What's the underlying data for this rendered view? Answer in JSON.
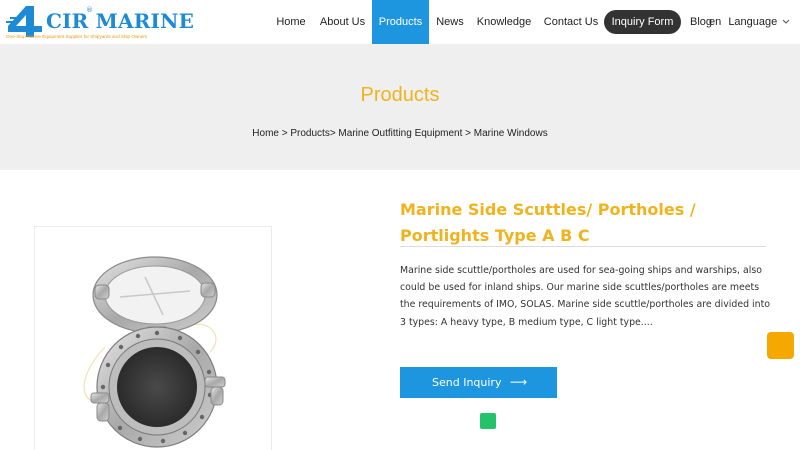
{
  "brand": {
    "name": "CIR MARINE",
    "registered": "®",
    "tagline": "One-Stop Marine Equipment Supplier for Shipyards and Ship Owners",
    "color": "#1d8ad6",
    "accent": "#e89a12"
  },
  "nav": {
    "items": [
      {
        "label": "Home"
      },
      {
        "label": "About Us"
      },
      {
        "label": "Products",
        "active": true
      },
      {
        "label": "News"
      },
      {
        "label": "Knowledge"
      },
      {
        "label": "Contact Us"
      }
    ],
    "inquiry_label": "Inquiry Form",
    "blog_label": "Blog",
    "lang_code": "en",
    "language_label": "Language",
    "active_color": "#1e96df"
  },
  "banner": {
    "title": "Products",
    "breadcrumb": "Home > Products> Marine Outfitting Equipment > Marine Windows"
  },
  "product": {
    "title": "Marine Side Scuttles/ Portholes / Portlights Type A B C",
    "description": "Marine side scuttle/portholes are used for sea-going ships and warships, also could be used for inland ships. Our marine side scuttles/portholes are meets the requirements of IMO, SOLAS. Marine side scuttle/portholes are divided into 3 types: A heavy type, B medium type, C light type....",
    "send_label": "Send Inquiry",
    "send_arrow": "⟶",
    "image_icon": "porthole-image"
  },
  "colors": {
    "title_accent": "#f0b31d",
    "button": "#1e96df",
    "float_button": "#f5a800",
    "green": "#24c26a"
  }
}
